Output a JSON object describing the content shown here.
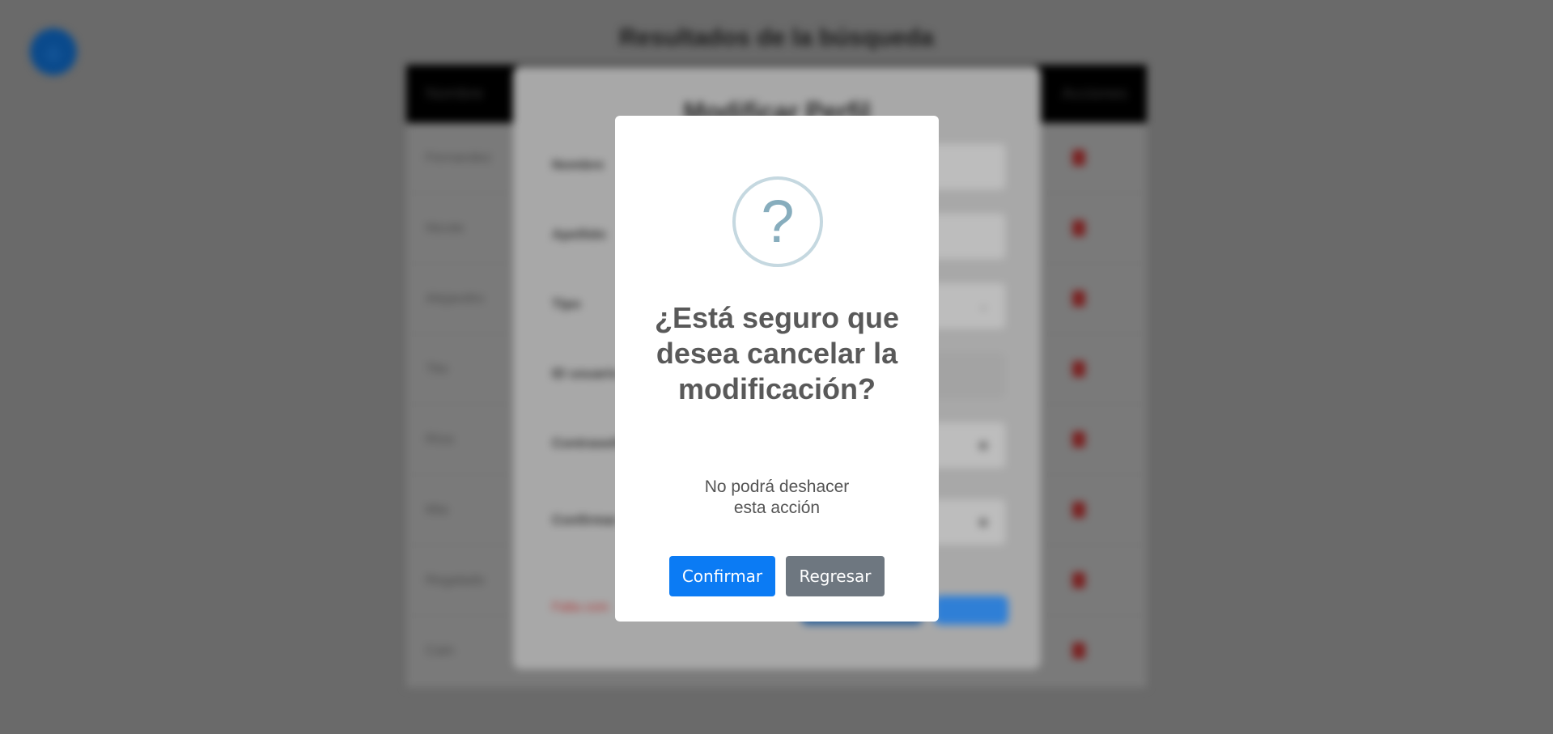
{
  "background": {
    "page_title": "Resultados de la búsqueda",
    "home_icon": "home-icon",
    "table": {
      "header_first": "Nombre",
      "header_last": "Acciones",
      "rows": [
        "Fernandez",
        "Nicole",
        "Alejandro",
        "Tito",
        "Ríos",
        "Mia",
        "Regalado",
        "Cain"
      ]
    },
    "edit_modal": {
      "title": "Modificar Perfil",
      "labels": [
        "Nombre",
        "Apellido",
        "Tipo",
        "ID usuario",
        "Contraseña",
        "Confirmar contraseña"
      ],
      "error_text": "Falta com"
    }
  },
  "dialog": {
    "icon": "?",
    "title": "¿Está seguro que desea cancelar la modificación?",
    "text": "No podrá deshacer esta acción",
    "confirm_label": "Confirmar",
    "cancel_label": "Regresar",
    "colors": {
      "confirm": "#0b7bf4",
      "cancel": "#6e7780",
      "icon": "#87adbd"
    }
  }
}
